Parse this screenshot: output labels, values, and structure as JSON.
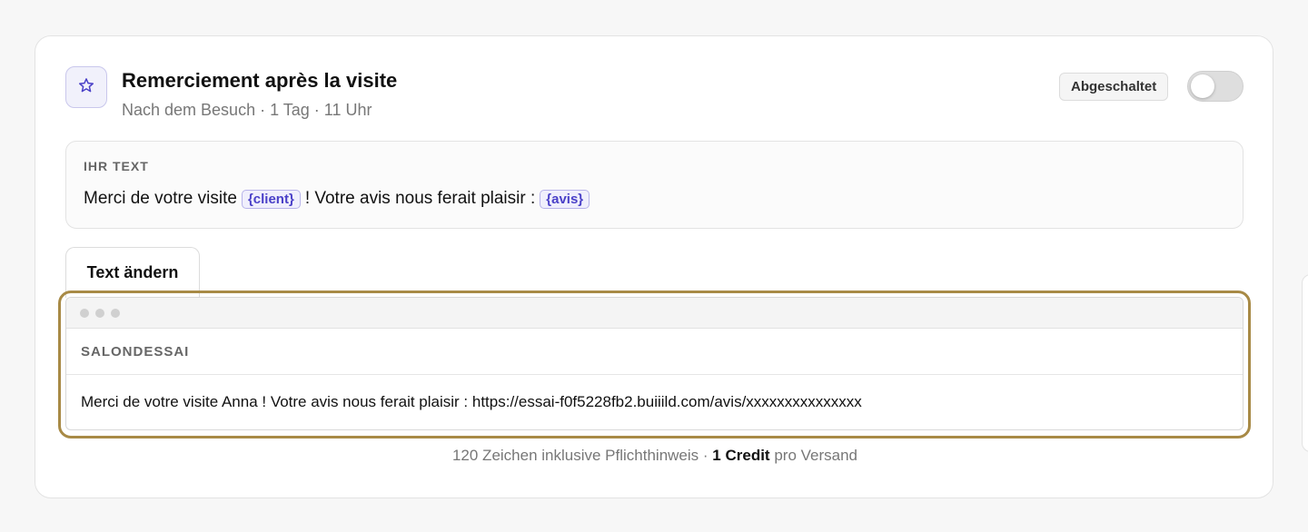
{
  "automation": {
    "title": "Remerciement après la visite",
    "subtitle": "Nach dem Besuch · 1 Tag · 11 Uhr",
    "status_label": "Abgeschaltet",
    "enabled": false,
    "icon": "star-icon"
  },
  "text_section": {
    "label": "IHR TEXT",
    "part1": "Merci de votre visite",
    "token1": "{client}",
    "part2": "! Votre avis nous ferait plaisir :",
    "token2": "{avis}"
  },
  "edit_button_label": "Text ändern",
  "preview": {
    "sender": "SALONDESSAI",
    "message": "Merci de votre visite Anna ! Votre avis nous ferait plaisir : https://essai-f0f5228fb2.buiiild.com/avis/xxxxxxxxxxxxxxx"
  },
  "footer": {
    "chars_text": "120 Zeichen inklusive Pflichthinweis ·",
    "credit_text": "1 Credit",
    "per_text": "pro Versand"
  },
  "colors": {
    "accent": "#4a40c8",
    "highlight_border": "#a88a46"
  }
}
